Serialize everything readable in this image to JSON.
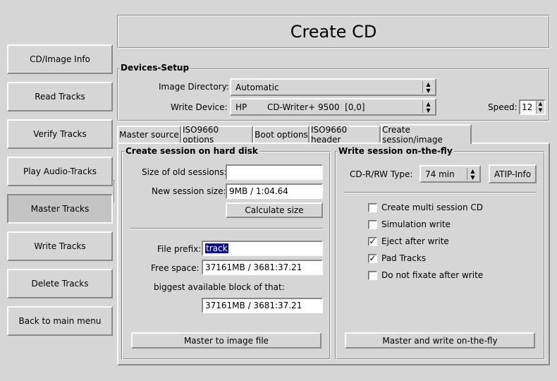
{
  "window": {
    "title": "Create CD"
  },
  "sidebar": {
    "items": [
      {
        "label": "CD/Image Info"
      },
      {
        "label": "Read Tracks"
      },
      {
        "label": "Verify Tracks"
      },
      {
        "label": "Play Audio-Tracks"
      },
      {
        "label": "Master Tracks"
      },
      {
        "label": "Write Tracks"
      },
      {
        "label": "Delete Tracks"
      },
      {
        "label": "Back to main menu"
      }
    ],
    "active_index": 4
  },
  "devices": {
    "title": "Devices-Setup",
    "image_dir_label": "Image Directory:",
    "image_dir_value": "Automatic",
    "write_device_label": "Write Device:",
    "write_device_vendor": "HP",
    "write_device_model": "CD-Writer+ 9500  [0,0]",
    "speed_label": "Speed:",
    "speed_value": "12"
  },
  "tabs": [
    {
      "label": "Master source"
    },
    {
      "label": "ISO9660 options"
    },
    {
      "label": "Boot options"
    },
    {
      "label": "ISO9660 header"
    },
    {
      "label": "Create session/image",
      "active": true
    }
  ],
  "hd_session": {
    "title": "Create session on hard disk",
    "old_sessions_label": "Size of old sessions:",
    "old_sessions_value": "",
    "new_session_label": "New session size:",
    "new_session_value": "9MB / 1:04.64",
    "calc_button": "Calculate size",
    "file_prefix_label": "File prefix:",
    "file_prefix_value": "track",
    "free_space_label": "Free space:",
    "free_space_value": "37161MB / 3681:37.21",
    "biggest_block_label": "biggest available block of that:",
    "biggest_block_value": "37161MB / 3681:37.21",
    "master_button": "Master to image file"
  },
  "fly_session": {
    "title": "Write session on-the-fly",
    "type_label": "CD-R/RW Type:",
    "type_value": "74 min",
    "atip_button": "ATIP-Info",
    "options": [
      {
        "label": "Create multi session CD",
        "checked": false
      },
      {
        "label": "Simulation write",
        "checked": false
      },
      {
        "label": "Eject after write",
        "checked": true
      },
      {
        "label": "Pad Tracks",
        "checked": true
      },
      {
        "label": "Do not fixate after write",
        "checked": false
      }
    ],
    "write_button": "Master and write on-the-fly"
  }
}
